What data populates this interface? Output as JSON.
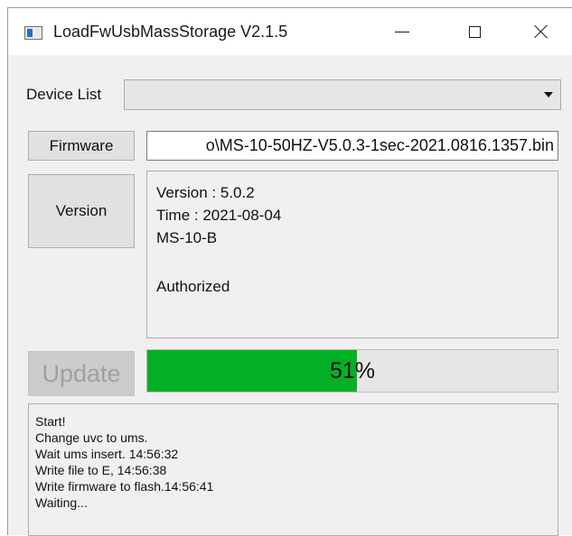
{
  "window": {
    "title": "LoadFwUsbMassStorage V2.1.5"
  },
  "device_list": {
    "label": "Device List",
    "selected": ""
  },
  "firmware": {
    "button_label": "Firmware",
    "path_display": "o\\MS-10-50HZ-V5.0.3-1sec-2021.0816.1357.bin"
  },
  "version": {
    "button_label": "Version",
    "lines": {
      "version": "Version : 5.0.2",
      "time": "Time : 2021-08-04",
      "model": "MS-10-B",
      "status": "Authorized"
    }
  },
  "update": {
    "button_label": "Update",
    "progress_percent": 51,
    "progress_text": "51%",
    "progress_color": "#06b025"
  },
  "log": {
    "lines": [
      "Start!",
      "Change uvc to ums.",
      "Wait ums insert. 14:56:32",
      "Write file to E, 14:56:38",
      "Write firmware to flash.14:56:41",
      "Waiting..."
    ]
  }
}
